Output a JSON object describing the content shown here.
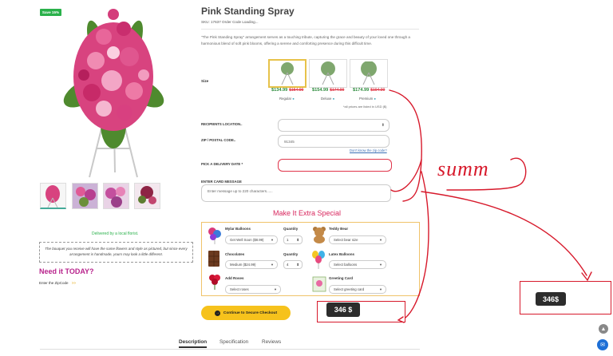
{
  "badge": {
    "save": "Save 15%"
  },
  "product": {
    "title": "Pink Standing Spray",
    "sku": "SKU: 17637    Order Code Loading...",
    "description": "\"The Pink Standing Spray\" arrangement serves as a touching tribute, capturing the grace and beauty of your loved one through a harmonious blend of soft pink blooms, offering a serene and comforting presence during this difficult time.",
    "size_label": "Size",
    "sizes": [
      {
        "price": "$134.99",
        "old": "$154.99",
        "tier": "Regular"
      },
      {
        "price": "$154.99",
        "old": "$174.99",
        "tier": "Deluxe"
      },
      {
        "price": "$174.99",
        "old": "$194.99",
        "tier": "Premium"
      }
    ],
    "usd_note": "*all prices are listed in USD ($)"
  },
  "form": {
    "recipient_label": "RECIPIENTS LOCATION..",
    "recipient_value": "",
    "zip_label": "ZIP / POSTAL CODE..",
    "zip_value": "91345",
    "dont_know": "Don't know the zip code?",
    "date_label": "PICK A DELIVERY DATE *",
    "card_label": "ENTER CARD MESSAGE",
    "card_placeholder": "Enter message up to 220 characters......"
  },
  "extras": {
    "title": "Make It Extra Special",
    "items": [
      {
        "name": "Mylar Balloons",
        "qty_label": "Quantity",
        "select": "Get Well Soon ($8.99)",
        "qty": "1"
      },
      {
        "name": "Teddy Bear",
        "select": "Select bear size"
      },
      {
        "name": "Chocolates",
        "qty_label": "Quantity",
        "select": "Medium ($24.99)",
        "qty": "4"
      },
      {
        "name": "Latex Balloons",
        "select": "Select balloons"
      },
      {
        "name": "Add Roses",
        "select": "Select roses"
      },
      {
        "name": "Greeting Card",
        "select": "Select greeting card"
      }
    ]
  },
  "checkout": {
    "label": "Continue to Secure Checkout"
  },
  "left": {
    "delivered": "Delivered by a local florist.",
    "note": "The bouquet you receive will have the same flowers and style as pictured, but since every arrangement is handmade, yours may look a little different.",
    "need_title": "Need it TODAY?",
    "zip_prompt": "Enter the ZipCode",
    "zip_arrow": ">>"
  },
  "tabs": [
    "Description",
    "Specification",
    "Reviews"
  ],
  "annotation": {
    "handwriting": "summ",
    "total_a": "346 $",
    "total_b": "346$"
  },
  "colors": {
    "accent": "#d8275e",
    "green": "#2ab14b",
    "yellow": "#f6c21c",
    "red_annot": "#d7192b"
  }
}
